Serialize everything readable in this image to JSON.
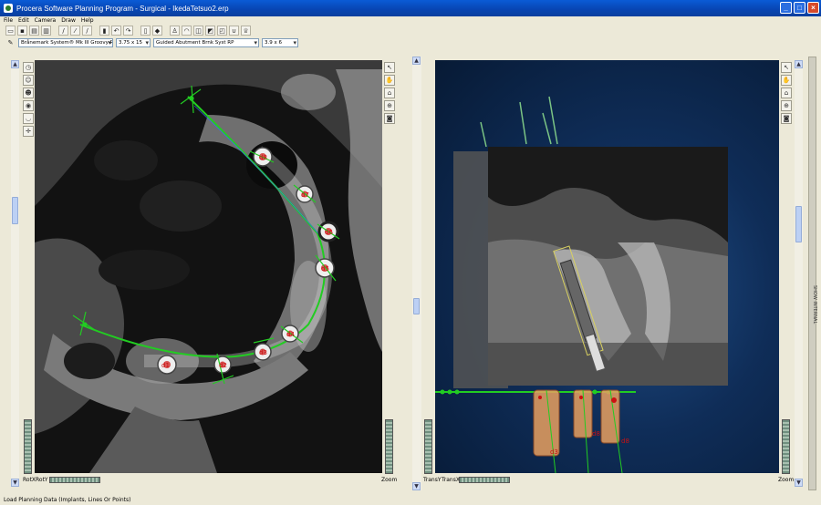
{
  "window": {
    "title": "Procera Software Planning Program - Surgical - IkedaTetsuo2.erp",
    "buttons": {
      "minimize": "_",
      "maximize": "□",
      "close": "×"
    }
  },
  "menu": [
    "File",
    "Edit",
    "Camera",
    "Draw",
    "Help"
  ],
  "toolbar2": {
    "implant_system": "Brånemark System® Mk III Groovy RP",
    "implant_size": "3.75 x 15",
    "abutment": "Guided Abutment Brnk Syst RP",
    "abutment_size": "3.9 x 6"
  },
  "left_view": {
    "rot_x_label": "RotX",
    "rot_y_label": "RotY",
    "zoom_label": "Zoom",
    "implant_labels": [
      "d1",
      "d2",
      "d3",
      "d4",
      "d5",
      "d6",
      "d7",
      "d8"
    ]
  },
  "right_view": {
    "trans_y_label": "TransY",
    "trans_x_label": "TransX",
    "zoom_label": "Zoom",
    "implant_labels": [
      "d3",
      "d8",
      "d8"
    ]
  },
  "side_panel": {
    "label": "SHOW INTERNAL"
  },
  "status": {
    "text": "Load Planning Data (Implants, Lines Or Points)"
  },
  "colors": {
    "titlebar": "#0a5bd6",
    "guide_line": "#22cc22",
    "implant_label": "#cc1111",
    "implant_body": "#e8a060"
  }
}
